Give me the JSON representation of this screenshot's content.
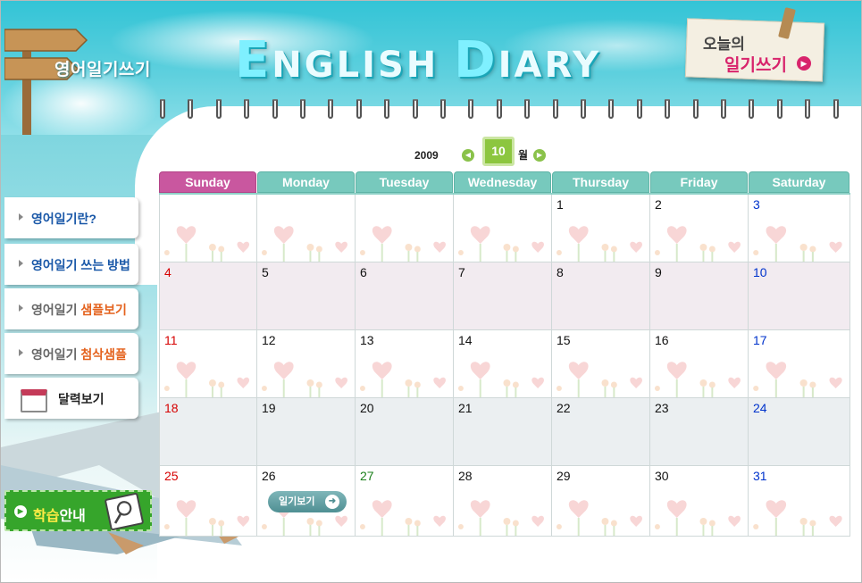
{
  "header": {
    "section_title": "영어일기쓰기",
    "logo_text": "ENGLISH DIARY",
    "today_card": {
      "line1": "오늘의",
      "line2": "일기쓰기"
    }
  },
  "sidebar": {
    "items": [
      {
        "label": "영어일기란?",
        "label_accent": ""
      },
      {
        "label": "영어일기 쓰는 방법",
        "label_accent": ""
      },
      {
        "label": "영어일기 ",
        "label_accent": "샘플보기"
      },
      {
        "label": "영어일기 ",
        "label_accent": "첨삭샘플"
      },
      {
        "label": "달력보기",
        "label_accent": ""
      }
    ],
    "study_guide": {
      "label_accent": "학습",
      "label": "안내"
    }
  },
  "calendar": {
    "year": "2009",
    "month": "10",
    "month_suffix": "월",
    "weekdays": [
      "Sunday",
      "Monday",
      "Tuesday",
      "Wednesday",
      "Thursday",
      "Friday",
      "Saturday"
    ],
    "weeks": [
      [
        "",
        "",
        "",
        "",
        "1",
        "2",
        "3"
      ],
      [
        "4",
        "5",
        "6",
        "7",
        "8",
        "9",
        "10"
      ],
      [
        "11",
        "12",
        "13",
        "14",
        "15",
        "16",
        "17"
      ],
      [
        "18",
        "19",
        "20",
        "21",
        "22",
        "23",
        "24"
      ],
      [
        "25",
        "26",
        "27",
        "28",
        "29",
        "30",
        "31"
      ]
    ],
    "row_styles": [
      "white",
      "pink",
      "white",
      "grey",
      "white"
    ],
    "holiday_dates": [
      "27"
    ],
    "diary_button": {
      "label": "일기보기",
      "date": "26"
    }
  },
  "colors": {
    "header_sky": "#33c4d6",
    "sunday_header": "#c9579f",
    "weekday_header": "#77c9bd",
    "sunday_date": "#d60000",
    "saturday_date": "#0033cc",
    "holiday_date": "#1a7f1a",
    "month_badge": "#8cc63f",
    "study_guide_bg": "#36a52b",
    "today_accent": "#d8246c"
  },
  "icons": [
    "signpost-icon",
    "prev-month-icon",
    "next-month-icon",
    "calendar-icon",
    "play-icon",
    "arrow-right-icon",
    "magnifier-icon",
    "pencils-decoration",
    "heart-flower-decoration",
    "spiral-ring-icon"
  ]
}
